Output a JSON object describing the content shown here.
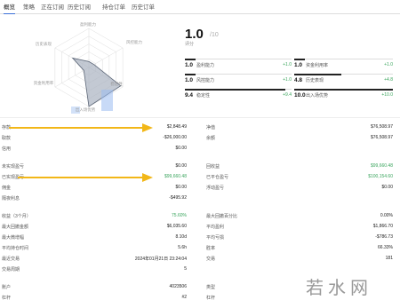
{
  "tabs": [
    "概览",
    "策略",
    "正在订阅",
    "历史订阅",
    "持仓订单",
    "历史订单"
  ],
  "radar": {
    "labels": [
      "盈利能力",
      "风控能力",
      "稳定性",
      "出入场优势",
      "资金利用率",
      "历史表现"
    ],
    "values": [
      1.0,
      1.0,
      9.4,
      10.0,
      1.0,
      4.8
    ]
  },
  "score": {
    "value": "1.0",
    "max": "/10",
    "label": "评分"
  },
  "metrics": [
    {
      "value": "1.0",
      "label": "盈利能力",
      "change": "+1.0"
    },
    {
      "value": "1.0",
      "label": "资金利用率",
      "change": "+1.0"
    },
    {
      "value": "1.0",
      "label": "风控能力",
      "change": "+1.0"
    },
    {
      "value": "4.8",
      "label": "历史表现",
      "change": "+4.8"
    },
    {
      "value": "9.4",
      "label": "稳定性",
      "change": "+9.4"
    },
    {
      "value": "10.0",
      "label": "出入场优势",
      "change": "+10.0"
    }
  ],
  "left_rows": [
    {
      "label": "存款",
      "value": "$2,848.49",
      "tone": ""
    },
    {
      "label": "取款",
      "value": "-$26,000.00",
      "tone": ""
    },
    {
      "label": "信用",
      "value": "$0.00",
      "tone": ""
    },
    {
      "label": "未实现盈亏",
      "value": "$0.00",
      "tone": ""
    },
    {
      "label": "已实现盈亏",
      "value": "$99,660.48",
      "tone": "green"
    },
    {
      "label": "佣金",
      "value": "$0.00",
      "tone": ""
    },
    {
      "label": "隔夜利息",
      "value": "-$495.92",
      "tone": ""
    },
    {
      "label": "收益（3个月）",
      "value": "75.60%",
      "tone": "green"
    },
    {
      "label": "最大回撤金额",
      "value": "$6,035.60",
      "tone": ""
    },
    {
      "label": "最大微增幅",
      "value": "8.10d",
      "tone": ""
    },
    {
      "label": "平均持仓时间",
      "value": "5.6h",
      "tone": ""
    },
    {
      "label": "最近交易",
      "value": "2024年01月21日 23:24:04",
      "tone": ""
    },
    {
      "label": "交易周期",
      "value": "5",
      "tone": ""
    },
    {
      "label": "账户",
      "value": "4023506",
      "tone": ""
    },
    {
      "label": "杠杆",
      "value": "#2",
      "tone": ""
    }
  ],
  "right_rows": [
    {
      "label": "净值",
      "value": "$76,508.97",
      "tone": ""
    },
    {
      "label": "余额",
      "value": "$76,508.97",
      "tone": ""
    },
    {
      "label": "回收益",
      "value": "$99,660.48",
      "tone": "green"
    },
    {
      "label": "已平仓盈亏",
      "value": "$100,154.60",
      "tone": "green"
    },
    {
      "label": "浮动盈亏",
      "value": "$0.00",
      "tone": ""
    },
    {
      "label": "最大回撤百分比",
      "value": "0.00%",
      "tone": ""
    },
    {
      "label": "平均盈利",
      "value": "$1,866.70",
      "tone": ""
    },
    {
      "label": "平均亏损",
      "value": "-$786.73",
      "tone": ""
    },
    {
      "label": "胜率",
      "value": "66.33%",
      "tone": ""
    },
    {
      "label": "交易",
      "value": "181",
      "tone": ""
    },
    {
      "label": "类型",
      "value": "",
      "tone": ""
    },
    {
      "label": "杠杆",
      "value": "",
      "tone": ""
    }
  ],
  "watermark": "若水网",
  "colors": {
    "accent": "#3a6fd8",
    "positive": "#3aa55d",
    "negative": "#d9534f",
    "arrow": "#f2b718"
  }
}
